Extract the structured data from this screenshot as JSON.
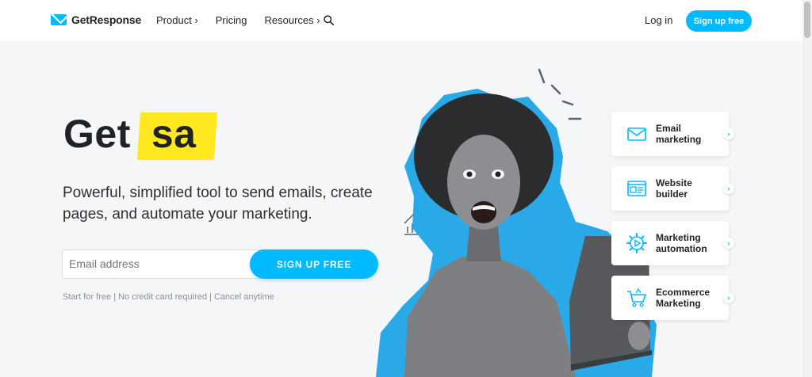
{
  "header": {
    "brand": "GetResponse",
    "nav": [
      {
        "label": "Product ›"
      },
      {
        "label": "Pricing"
      },
      {
        "label": "Resources ›"
      }
    ],
    "search_icon": "search-icon",
    "login_label": "Log in",
    "signup_label": "Sign up free"
  },
  "hero": {
    "title_static": "Get",
    "title_highlight": "sa",
    "subtitle": "Powerful, simplified tool to send emails, create pages, and automate your marketing.",
    "email_placeholder": "Email address",
    "signup_label": "SIGN UP FREE",
    "disclaimer": "Start for free | No credit card required | Cancel anytime"
  },
  "features": [
    {
      "label": "Email\nmarketing",
      "icon": "envelope-icon"
    },
    {
      "label": "Website\nbuilder",
      "icon": "website-icon"
    },
    {
      "label": "Marketing\nautomation",
      "icon": "gear-play-icon"
    },
    {
      "label": "Ecommerce\nMarketing",
      "icon": "cart-icon"
    }
  ],
  "colors": {
    "accent": "#00baff",
    "highlight": "#ffe81f",
    "text": "#1f2226"
  }
}
